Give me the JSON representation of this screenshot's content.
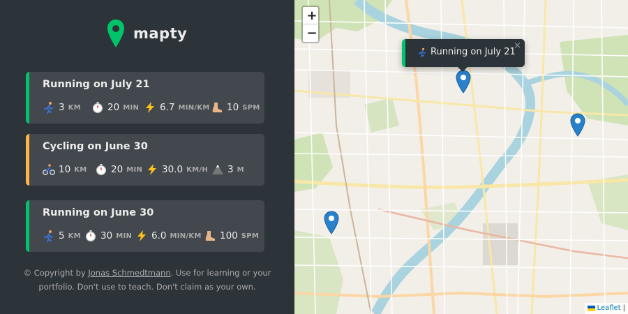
{
  "app": {
    "name": "mapty"
  },
  "colors": {
    "running": "#00c46a",
    "cycling": "#ffb545",
    "sidebar": "#2d3439",
    "card": "#42484d",
    "marker": "#2a81cb"
  },
  "workouts": [
    {
      "type": "running",
      "title": "Running on July 21",
      "stats": [
        {
          "icon": "running-person-icon",
          "value": "3",
          "unit": "km"
        },
        {
          "icon": "stopwatch-icon",
          "value": "20",
          "unit": "min"
        },
        {
          "icon": "lightning-icon",
          "value": "6.7",
          "unit": "min/km"
        },
        {
          "icon": "foot-icon",
          "value": "10",
          "unit": "spm"
        }
      ]
    },
    {
      "type": "cycling",
      "title": "Cycling on June 30",
      "stats": [
        {
          "icon": "cyclist-icon",
          "value": "10",
          "unit": "km"
        },
        {
          "icon": "stopwatch-icon",
          "value": "20",
          "unit": "min"
        },
        {
          "icon": "lightning-icon",
          "value": "30.0",
          "unit": "km/h"
        },
        {
          "icon": "mountain-icon",
          "value": "3",
          "unit": "m"
        }
      ]
    },
    {
      "type": "running",
      "title": "Running on June 30",
      "stats": [
        {
          "icon": "running-person-icon",
          "value": "5",
          "unit": "km"
        },
        {
          "icon": "stopwatch-icon",
          "value": "30",
          "unit": "min"
        },
        {
          "icon": "lightning-icon",
          "value": "6.0",
          "unit": "min/km"
        },
        {
          "icon": "foot-icon",
          "value": "100",
          "unit": "spm"
        }
      ]
    }
  ],
  "copyright": {
    "prefix": "© Copyright by ",
    "author": "Jonas Schmedtmann",
    "suffix": ". Use for learning or your portfolio. Don't use to teach. Don't claim as your own."
  },
  "map": {
    "zoom_in": "+",
    "zoom_out": "−",
    "popup": {
      "text": "Running on July 21",
      "close": "×"
    },
    "attribution": "Leaflet",
    "attribution_sep": "|"
  }
}
